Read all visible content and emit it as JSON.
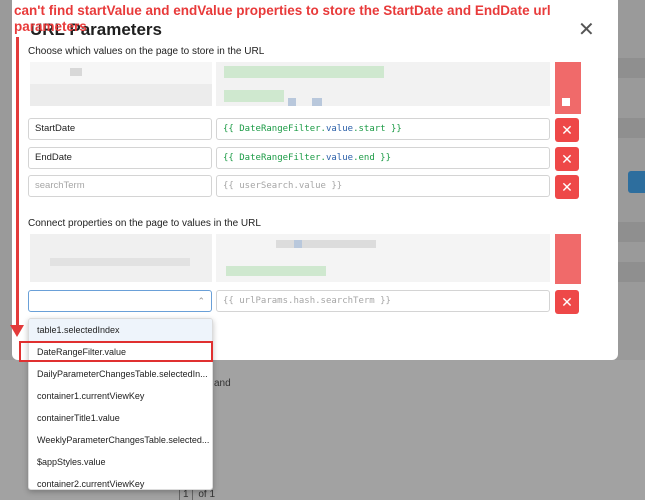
{
  "annotation": {
    "text": "can't find startValue and endValue properties to store the StartDate and EndDate url parameters"
  },
  "modal": {
    "title": "URL Parameters",
    "close_glyph": "✕"
  },
  "store_section": {
    "label": "Choose which values on the page to store in the URL",
    "rows": [
      {
        "key": "StartDate",
        "value_prefix": "{{ ",
        "value_obj": "DateRangeFilter",
        "value_dot1": ".",
        "value_prop": "value",
        "value_dot2": ".",
        "value_sub": "start",
        "value_suffix": " }}"
      },
      {
        "key": "EndDate",
        "value_prefix": "{{ ",
        "value_obj": "DateRangeFilter",
        "value_dot1": ".",
        "value_prop": "value",
        "value_dot2": ".",
        "value_sub": "end",
        "value_suffix": " }}"
      }
    ],
    "placeholder_row": {
      "key_placeholder": "searchTerm",
      "value_placeholder": "{{ userSearch.value }}"
    }
  },
  "connect_section": {
    "label": "Connect properties on the page to values in the URL",
    "select_value": "",
    "value_placeholder": "{{ urlParams.hash.searchTerm }}",
    "chevron": "⌃"
  },
  "dropdown": {
    "options": [
      "table1.selectedIndex",
      "DateRangeFilter.value",
      "DailyParameterChangesTable.selectedIn...",
      "container1.currentViewKey",
      "containerTitle1.value",
      "WeeklyParameterChangesTable.selected...",
      "$appStyles.value",
      "container2.currentViewKey"
    ]
  },
  "background": {
    "and_text": "and",
    "pager": {
      "current": "1",
      "of_text": "of 1"
    }
  },
  "colors": {
    "danger": "#ee4848",
    "annotation": "#e83a3a",
    "template_green": "#1c9b46"
  },
  "icons": {
    "delete": "close-icon",
    "close": "close-icon",
    "chevron": "chevron-up-icon",
    "arrow": "arrow-down-annotation"
  }
}
